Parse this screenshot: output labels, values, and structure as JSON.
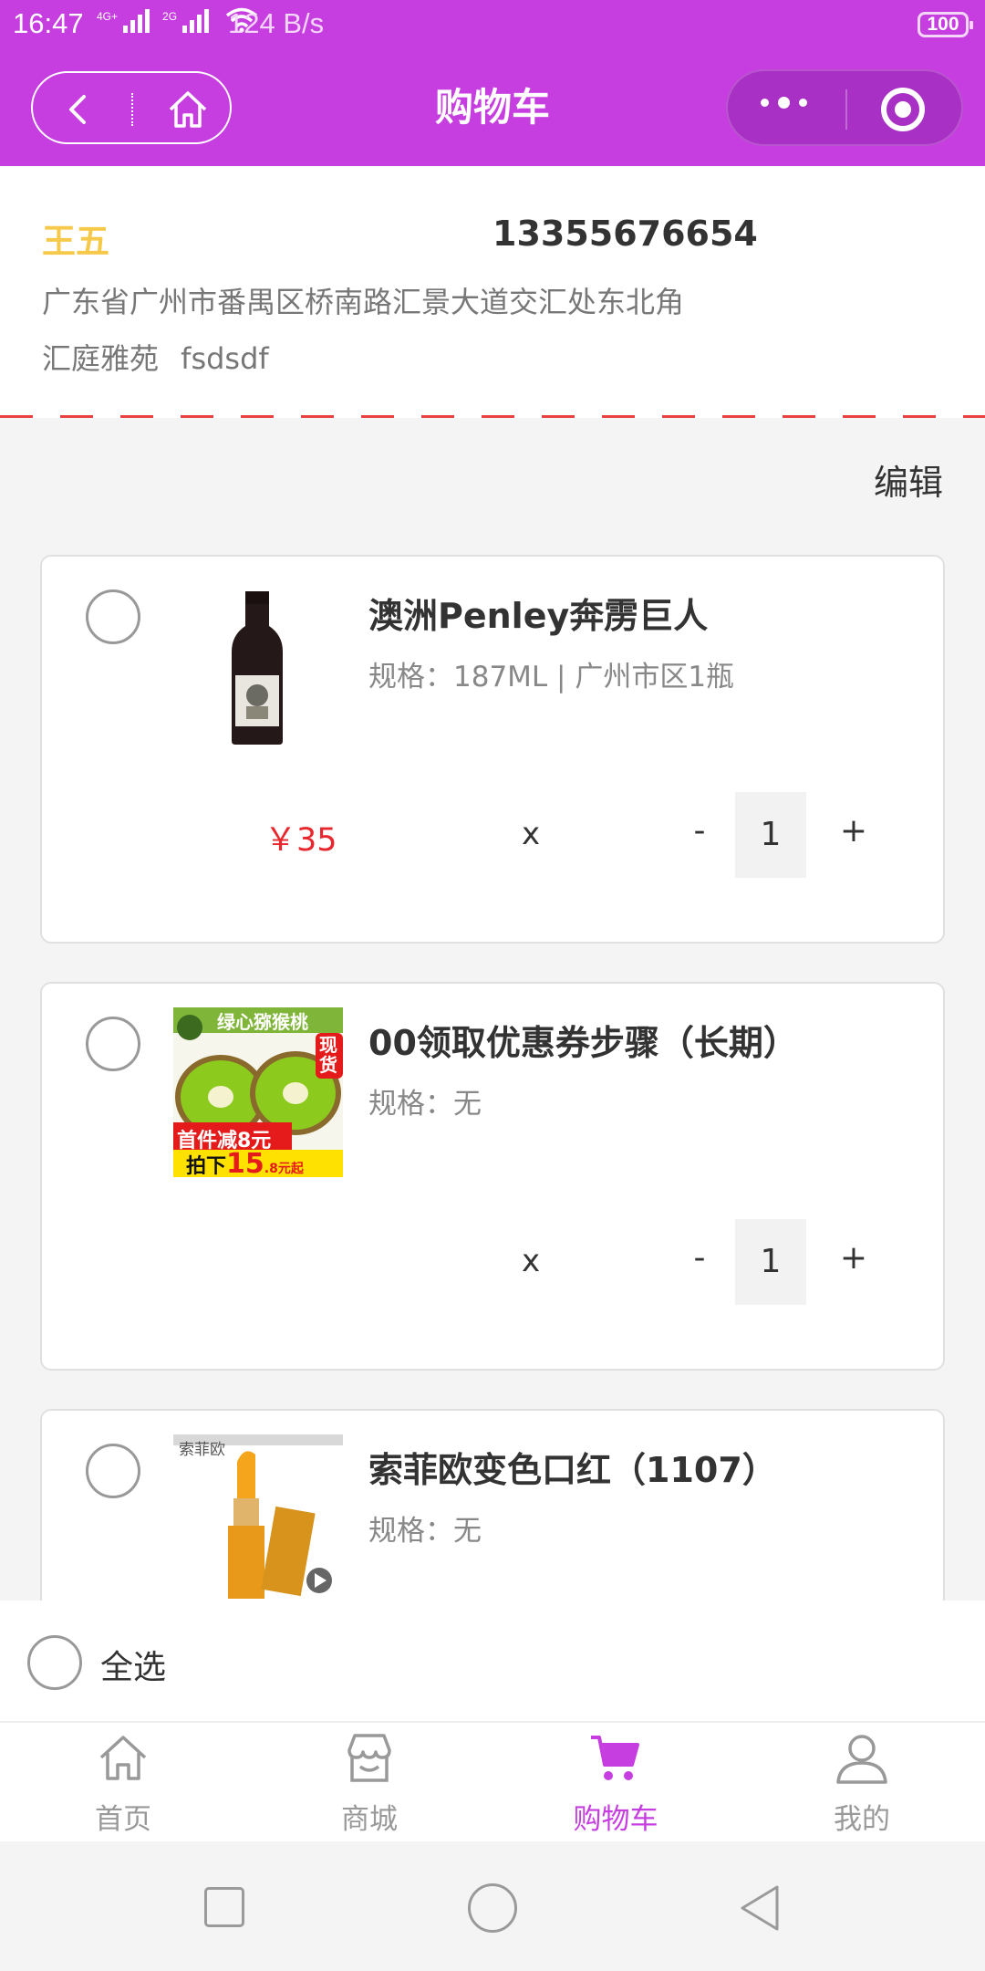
{
  "status_bar": {
    "time": "16:47",
    "net1": "4G+",
    "net2": "2G",
    "speed": "124 B/s",
    "battery": "100"
  },
  "nav": {
    "title": "购物车",
    "accent_color": "#c63ee0"
  },
  "address": {
    "name": "王五",
    "phone": "13355676654",
    "line1": "广东省广州市番禺区桥南路汇景大道交汇处东北角",
    "line2": "汇庭雅苑 fsdsdf"
  },
  "edit_label": "编辑",
  "items": [
    {
      "title": "澳洲Penley奔雳巨人",
      "spec": "规格：187ML | 广州市区1瓶",
      "price": "￥35",
      "times": "x",
      "minus": "-",
      "qty": "1",
      "plus": "+",
      "image_icon": "wine-bottle-image"
    },
    {
      "title": "00领取优惠券步骤（长期）",
      "spec": "规格：无",
      "price": "",
      "times": "x",
      "minus": "-",
      "qty": "1",
      "plus": "+",
      "image_icon": "kiwi-promo-image",
      "image_text": {
        "banner": "绿心猕猴桃",
        "stock": "现货",
        "deal": "首件减8元",
        "price_prefix": "拍下",
        "price_big": "15",
        "price_small": ".8元起"
      }
    },
    {
      "title": "索菲欧变色口红（1107）",
      "spec": "规格：无",
      "image_icon": "lipstick-image",
      "image_text": {
        "brand": "索菲欧"
      }
    }
  ],
  "select_all_label": "全选",
  "tabs": [
    {
      "label": "首页",
      "icon": "home-icon"
    },
    {
      "label": "商城",
      "icon": "store-icon"
    },
    {
      "label": "购物车",
      "icon": "cart-icon",
      "active": true
    },
    {
      "label": "我的",
      "icon": "user-icon"
    }
  ]
}
